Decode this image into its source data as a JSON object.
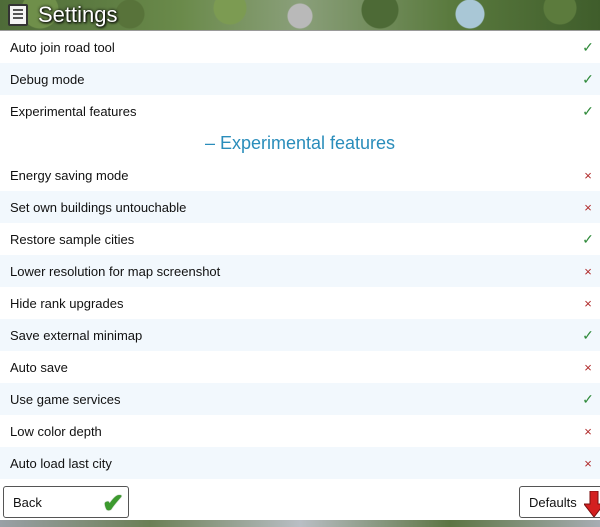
{
  "window": {
    "title": "Settings",
    "icon": "notepad-icon"
  },
  "settings": [
    {
      "label": "Auto join road tool",
      "enabled": true
    },
    {
      "label": "Debug mode",
      "enabled": true
    },
    {
      "label": "Experimental features",
      "enabled": true
    }
  ],
  "section_title": "– Experimental features",
  "experimental": [
    {
      "label": "Energy saving mode",
      "enabled": false
    },
    {
      "label": "Set own buildings untouchable",
      "enabled": false
    },
    {
      "label": "Restore sample cities",
      "enabled": true
    },
    {
      "label": "Lower resolution for map screenshot",
      "enabled": false
    },
    {
      "label": "Hide rank upgrades",
      "enabled": false
    },
    {
      "label": "Save external minimap",
      "enabled": true
    },
    {
      "label": "Auto save",
      "enabled": false
    },
    {
      "label": "Use game services",
      "enabled": true
    },
    {
      "label": "Low color depth",
      "enabled": false
    },
    {
      "label": "Auto load last city",
      "enabled": false
    }
  ],
  "marks": {
    "on": "✓",
    "off": "×"
  },
  "buttons": {
    "back_label": "Back",
    "defaults_label": "Defaults"
  },
  "colors": {
    "on": "#2f8a3a",
    "off": "#b02a2a",
    "heading": "#2a8dbb",
    "alt_row": "#f2f8fd"
  }
}
